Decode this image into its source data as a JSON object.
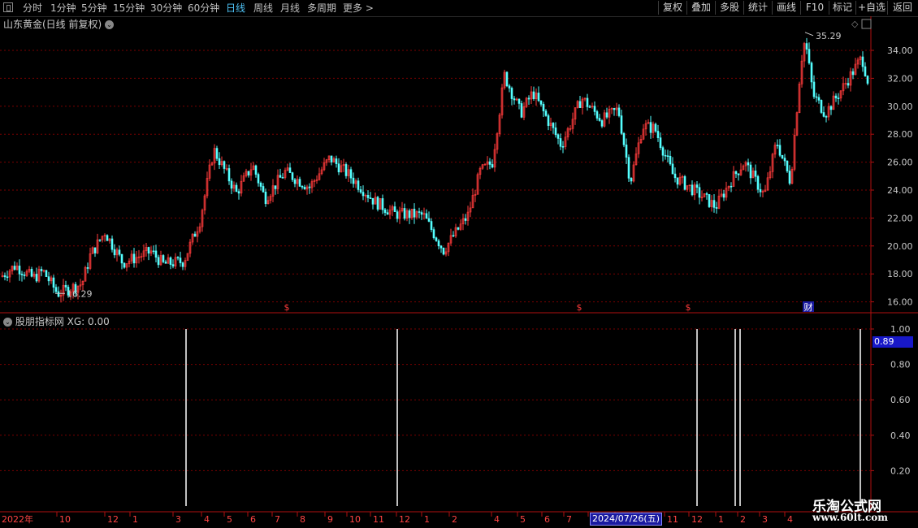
{
  "toolbar": {
    "periods": [
      "分时",
      "1分钟",
      "5分钟",
      "15分钟",
      "30分钟",
      "60分钟",
      "日线",
      "周线",
      "月线",
      "多周期",
      "更多 >"
    ],
    "active_period": "日线",
    "buttons": [
      "复权",
      "叠加",
      "多股",
      "统计",
      "画线",
      "F10",
      "+自选",
      "返回"
    ],
    "mark_btn": "标记"
  },
  "main_chart": {
    "title": "山东黄金(日线 前复权)",
    "y_ticks": [
      "34.00",
      "32.00",
      "30.00",
      "28.00",
      "26.00",
      "24.00",
      "22.00",
      "20.00",
      "18.00",
      "16.00"
    ],
    "high_label": "35.29",
    "low_label": "16.29",
    "markers": [
      "$",
      "$",
      "$",
      "财"
    ],
    "colors": {
      "up": "#ff3b3b",
      "down": "#54ffff",
      "grid": "#7a0000",
      "axis": "#b01010"
    }
  },
  "indicator": {
    "title": "股朋指标网 XG: 0.00",
    "y_ticks": [
      "1.00",
      "0.80",
      "0.60",
      "0.40",
      "0.20"
    ],
    "current_value": "0.89"
  },
  "x_axis": {
    "labels": [
      "2022年",
      "10",
      "12",
      "1",
      "3",
      "4",
      "5",
      "6",
      "7",
      "8",
      "9",
      "10",
      "11",
      "12",
      "1",
      "2",
      "4",
      "5",
      "6",
      "7",
      "8",
      "9",
      "10",
      "11",
      "12",
      "1",
      "2",
      "3",
      "4"
    ],
    "date_tag": "2024/07/26(五)"
  },
  "watermark": {
    "line1": "乐淘公式网",
    "line2": "www.60lt.com"
  }
}
